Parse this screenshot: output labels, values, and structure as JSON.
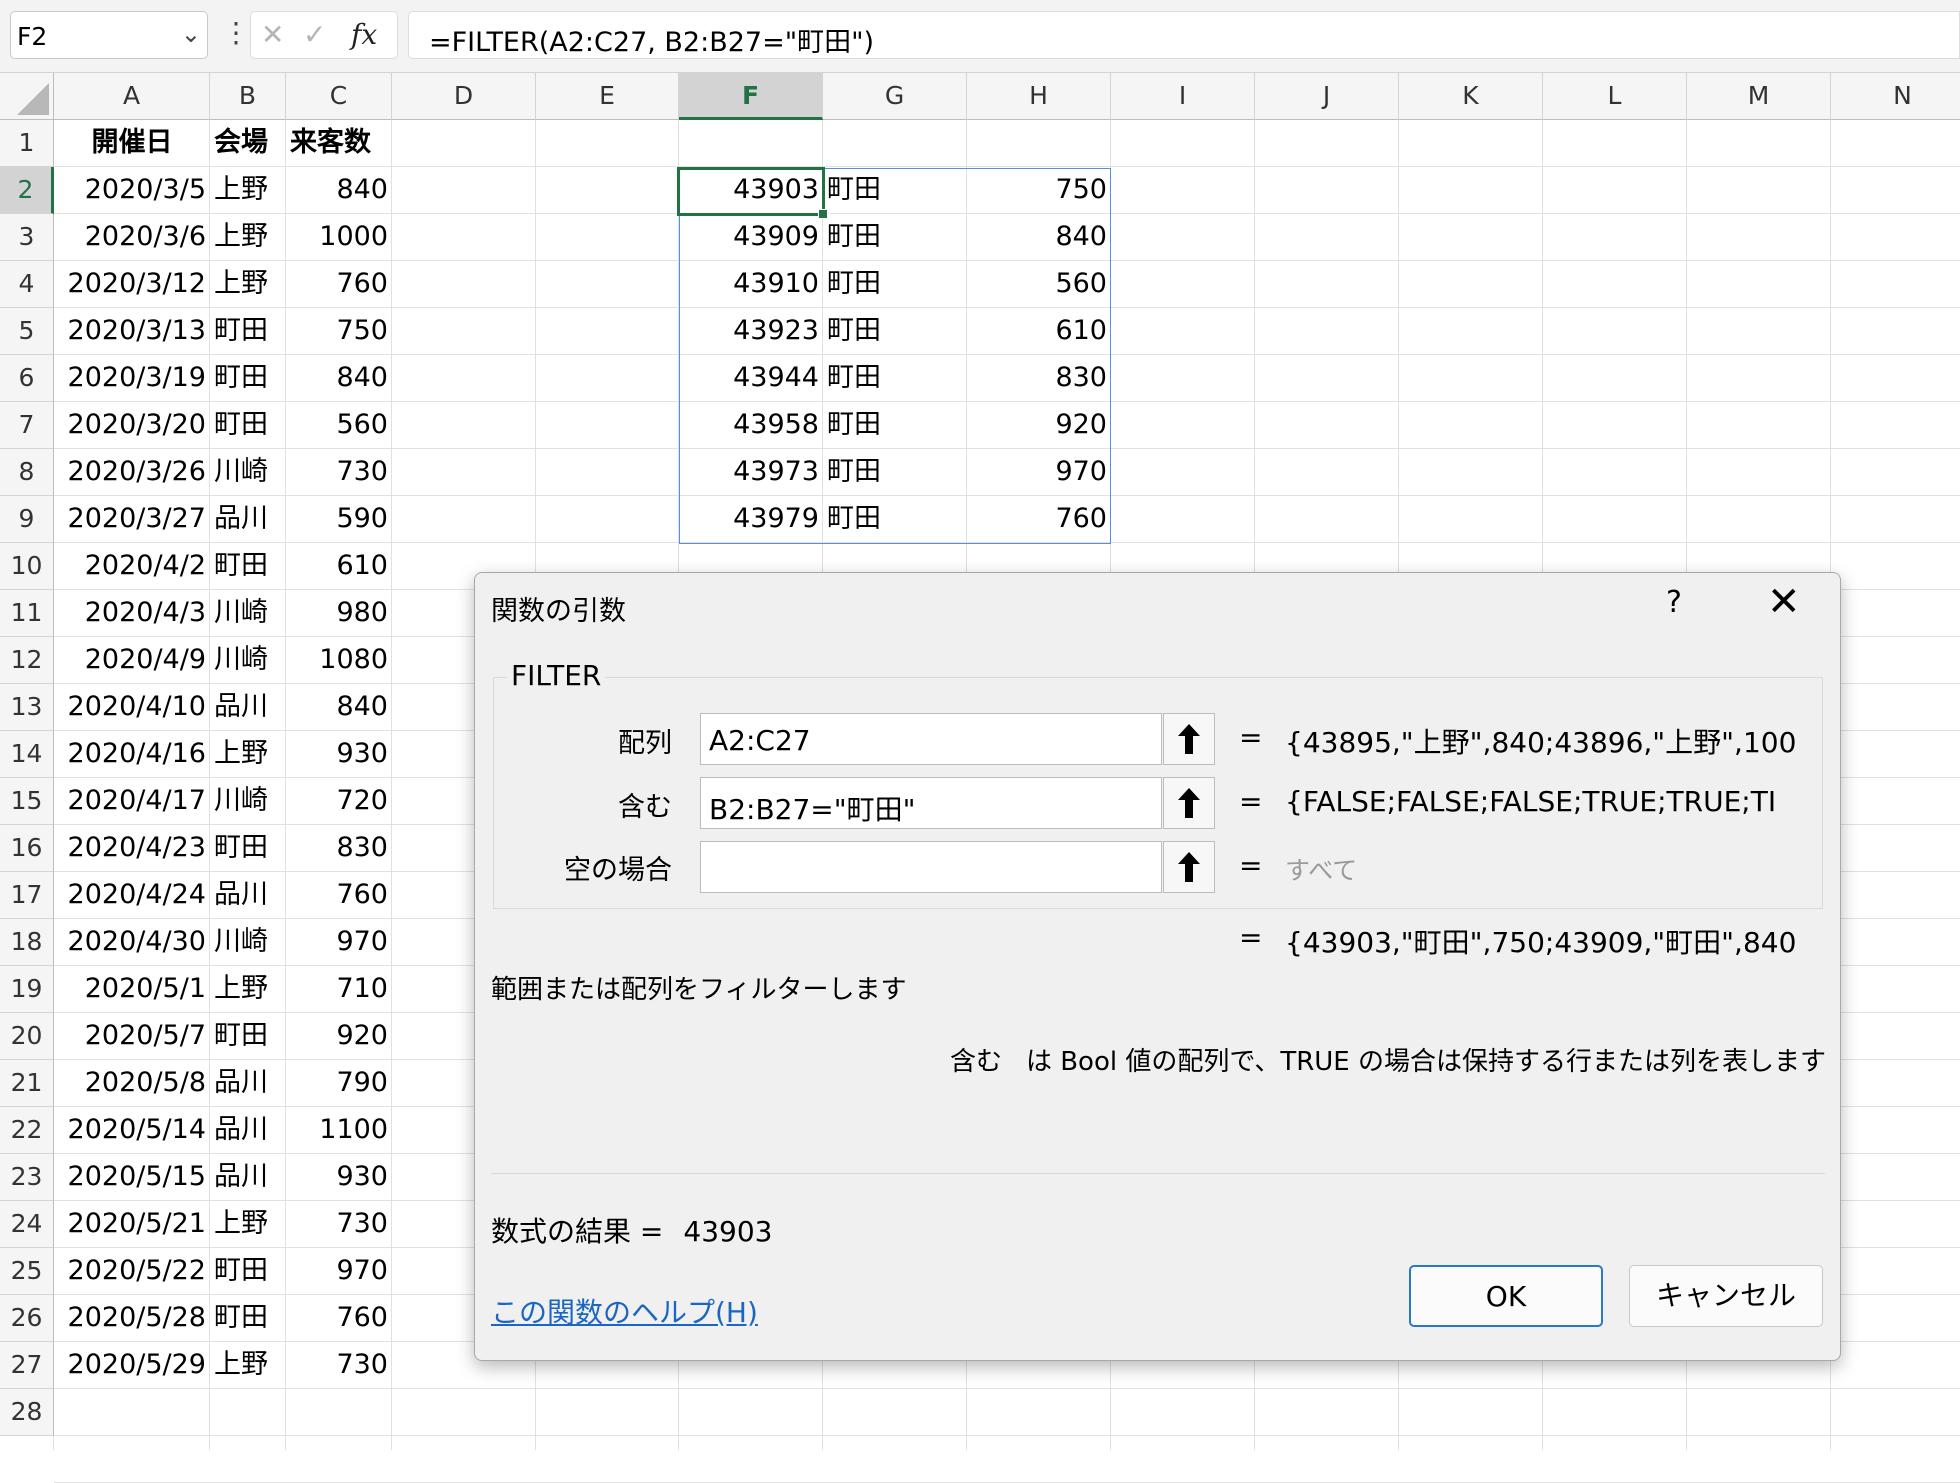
{
  "formula_bar": {
    "name_box": "F2",
    "formula": "=FILTER(A2:C27, B2:B27=\"町田\")"
  },
  "columns": [
    "A",
    "B",
    "C",
    "D",
    "E",
    "F",
    "G",
    "H",
    "I",
    "J",
    "K",
    "L",
    "M",
    "N"
  ],
  "rows": [
    "1",
    "2",
    "3",
    "4",
    "5",
    "6",
    "7",
    "8",
    "9",
    "10",
    "11",
    "12",
    "13",
    "14",
    "15",
    "16",
    "17",
    "18",
    "19",
    "20",
    "21",
    "22",
    "23",
    "24",
    "25",
    "26",
    "27",
    "28"
  ],
  "headers": {
    "date": "開催日",
    "venue": "会場",
    "visitors": "来客数"
  },
  "table": [
    [
      "2020/3/5",
      "上野",
      "840"
    ],
    [
      "2020/3/6",
      "上野",
      "1000"
    ],
    [
      "2020/3/12",
      "上野",
      "760"
    ],
    [
      "2020/3/13",
      "町田",
      "750"
    ],
    [
      "2020/3/19",
      "町田",
      "840"
    ],
    [
      "2020/3/20",
      "町田",
      "560"
    ],
    [
      "2020/3/26",
      "川崎",
      "730"
    ],
    [
      "2020/3/27",
      "品川",
      "590"
    ],
    [
      "2020/4/2",
      "町田",
      "610"
    ],
    [
      "2020/4/3",
      "川崎",
      "980"
    ],
    [
      "2020/4/9",
      "川崎",
      "1080"
    ],
    [
      "2020/4/10",
      "品川",
      "840"
    ],
    [
      "2020/4/16",
      "上野",
      "930"
    ],
    [
      "2020/4/17",
      "川崎",
      "720"
    ],
    [
      "2020/4/23",
      "町田",
      "830"
    ],
    [
      "2020/4/24",
      "品川",
      "760"
    ],
    [
      "2020/4/30",
      "川崎",
      "970"
    ],
    [
      "2020/5/1",
      "上野",
      "710"
    ],
    [
      "2020/5/7",
      "町田",
      "920"
    ],
    [
      "2020/5/8",
      "品川",
      "790"
    ],
    [
      "2020/5/14",
      "品川",
      "1100"
    ],
    [
      "2020/5/15",
      "品川",
      "930"
    ],
    [
      "2020/5/21",
      "上野",
      "730"
    ],
    [
      "2020/5/22",
      "町田",
      "970"
    ],
    [
      "2020/5/28",
      "町田",
      "760"
    ],
    [
      "2020/5/29",
      "上野",
      "730"
    ]
  ],
  "spill": [
    [
      "43903",
      "町田",
      "750"
    ],
    [
      "43909",
      "町田",
      "840"
    ],
    [
      "43910",
      "町田",
      "560"
    ],
    [
      "43923",
      "町田",
      "610"
    ],
    [
      "43944",
      "町田",
      "830"
    ],
    [
      "43958",
      "町田",
      "920"
    ],
    [
      "43973",
      "町田",
      "970"
    ],
    [
      "43979",
      "町田",
      "760"
    ]
  ],
  "dialog": {
    "title": "関数の引数",
    "help_glyph": "?",
    "close_glyph": "✕",
    "function_name": "FILTER",
    "args": [
      {
        "label": "配列",
        "value": "A2:C27",
        "result": "{43895,\"上野\",840;43896,\"上野\",100"
      },
      {
        "label": "含む",
        "value": "B2:B27=\"町田\"",
        "result": "{FALSE;FALSE;FALSE;TRUE;TRUE;TI"
      },
      {
        "label": "空の場合",
        "value": "",
        "result": "すべて"
      }
    ],
    "equals": "=",
    "result_preview": "{43903,\"町田\",750;43909,\"町田\",840",
    "description": "範囲または配列をフィルターします",
    "arg_desc_name": "含む",
    "arg_desc_text": "は Bool 値の配列で、TRUE の場合は保持する行または列を表します",
    "formula_result_label": "数式の結果 =",
    "formula_result_value": "43903",
    "help_link": "この関数のヘルプ(H)",
    "ok": "OK",
    "cancel": "キャンセル"
  }
}
